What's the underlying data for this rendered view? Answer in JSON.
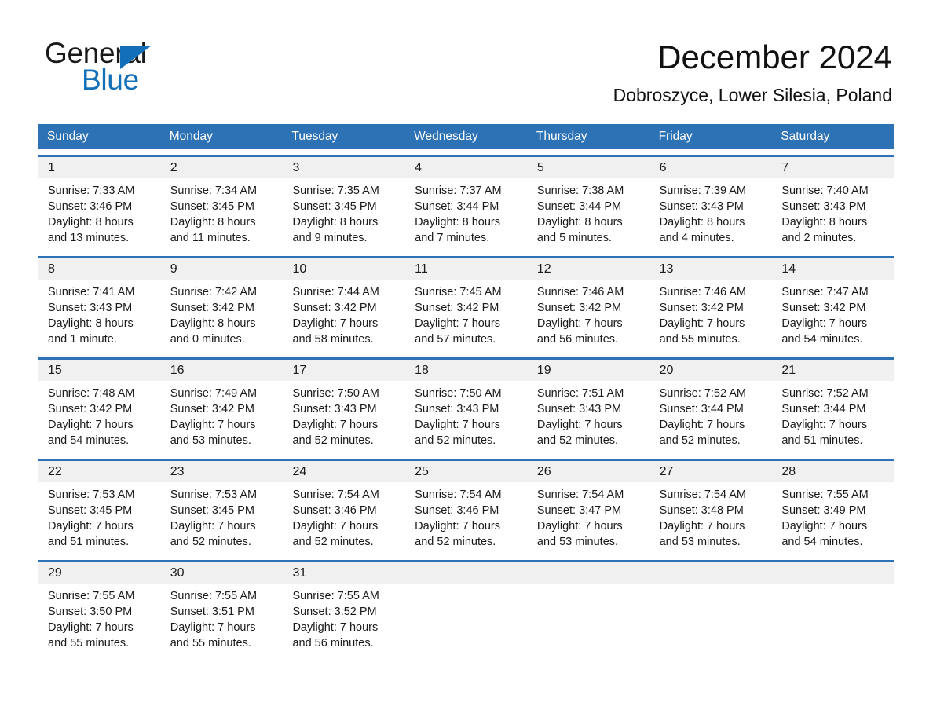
{
  "brand": {
    "name_dark": "General",
    "name_light": "Blue",
    "triangle_color": "#136fb7"
  },
  "header": {
    "title": "December 2024",
    "subtitle": "Dobroszyce, Lower Silesia, Poland",
    "accent_color": "#2d72b4",
    "daynum_band_color": "#f0f0f0"
  },
  "calendar": {
    "weekdays": [
      "Sunday",
      "Monday",
      "Tuesday",
      "Wednesday",
      "Thursday",
      "Friday",
      "Saturday"
    ],
    "weeks": [
      [
        {
          "day": "1",
          "sunrise": "Sunrise: 7:33 AM",
          "sunset": "Sunset: 3:46 PM",
          "daylight_1": "Daylight: 8 hours",
          "daylight_2": "and 13 minutes."
        },
        {
          "day": "2",
          "sunrise": "Sunrise: 7:34 AM",
          "sunset": "Sunset: 3:45 PM",
          "daylight_1": "Daylight: 8 hours",
          "daylight_2": "and 11 minutes."
        },
        {
          "day": "3",
          "sunrise": "Sunrise: 7:35 AM",
          "sunset": "Sunset: 3:45 PM",
          "daylight_1": "Daylight: 8 hours",
          "daylight_2": "and 9 minutes."
        },
        {
          "day": "4",
          "sunrise": "Sunrise: 7:37 AM",
          "sunset": "Sunset: 3:44 PM",
          "daylight_1": "Daylight: 8 hours",
          "daylight_2": "and 7 minutes."
        },
        {
          "day": "5",
          "sunrise": "Sunrise: 7:38 AM",
          "sunset": "Sunset: 3:44 PM",
          "daylight_1": "Daylight: 8 hours",
          "daylight_2": "and 5 minutes."
        },
        {
          "day": "6",
          "sunrise": "Sunrise: 7:39 AM",
          "sunset": "Sunset: 3:43 PM",
          "daylight_1": "Daylight: 8 hours",
          "daylight_2": "and 4 minutes."
        },
        {
          "day": "7",
          "sunrise": "Sunrise: 7:40 AM",
          "sunset": "Sunset: 3:43 PM",
          "daylight_1": "Daylight: 8 hours",
          "daylight_2": "and 2 minutes."
        }
      ],
      [
        {
          "day": "8",
          "sunrise": "Sunrise: 7:41 AM",
          "sunset": "Sunset: 3:43 PM",
          "daylight_1": "Daylight: 8 hours",
          "daylight_2": "and 1 minute."
        },
        {
          "day": "9",
          "sunrise": "Sunrise: 7:42 AM",
          "sunset": "Sunset: 3:42 PM",
          "daylight_1": "Daylight: 8 hours",
          "daylight_2": "and 0 minutes."
        },
        {
          "day": "10",
          "sunrise": "Sunrise: 7:44 AM",
          "sunset": "Sunset: 3:42 PM",
          "daylight_1": "Daylight: 7 hours",
          "daylight_2": "and 58 minutes."
        },
        {
          "day": "11",
          "sunrise": "Sunrise: 7:45 AM",
          "sunset": "Sunset: 3:42 PM",
          "daylight_1": "Daylight: 7 hours",
          "daylight_2": "and 57 minutes."
        },
        {
          "day": "12",
          "sunrise": "Sunrise: 7:46 AM",
          "sunset": "Sunset: 3:42 PM",
          "daylight_1": "Daylight: 7 hours",
          "daylight_2": "and 56 minutes."
        },
        {
          "day": "13",
          "sunrise": "Sunrise: 7:46 AM",
          "sunset": "Sunset: 3:42 PM",
          "daylight_1": "Daylight: 7 hours",
          "daylight_2": "and 55 minutes."
        },
        {
          "day": "14",
          "sunrise": "Sunrise: 7:47 AM",
          "sunset": "Sunset: 3:42 PM",
          "daylight_1": "Daylight: 7 hours",
          "daylight_2": "and 54 minutes."
        }
      ],
      [
        {
          "day": "15",
          "sunrise": "Sunrise: 7:48 AM",
          "sunset": "Sunset: 3:42 PM",
          "daylight_1": "Daylight: 7 hours",
          "daylight_2": "and 54 minutes."
        },
        {
          "day": "16",
          "sunrise": "Sunrise: 7:49 AM",
          "sunset": "Sunset: 3:42 PM",
          "daylight_1": "Daylight: 7 hours",
          "daylight_2": "and 53 minutes."
        },
        {
          "day": "17",
          "sunrise": "Sunrise: 7:50 AM",
          "sunset": "Sunset: 3:43 PM",
          "daylight_1": "Daylight: 7 hours",
          "daylight_2": "and 52 minutes."
        },
        {
          "day": "18",
          "sunrise": "Sunrise: 7:50 AM",
          "sunset": "Sunset: 3:43 PM",
          "daylight_1": "Daylight: 7 hours",
          "daylight_2": "and 52 minutes."
        },
        {
          "day": "19",
          "sunrise": "Sunrise: 7:51 AM",
          "sunset": "Sunset: 3:43 PM",
          "daylight_1": "Daylight: 7 hours",
          "daylight_2": "and 52 minutes."
        },
        {
          "day": "20",
          "sunrise": "Sunrise: 7:52 AM",
          "sunset": "Sunset: 3:44 PM",
          "daylight_1": "Daylight: 7 hours",
          "daylight_2": "and 52 minutes."
        },
        {
          "day": "21",
          "sunrise": "Sunrise: 7:52 AM",
          "sunset": "Sunset: 3:44 PM",
          "daylight_1": "Daylight: 7 hours",
          "daylight_2": "and 51 minutes."
        }
      ],
      [
        {
          "day": "22",
          "sunrise": "Sunrise: 7:53 AM",
          "sunset": "Sunset: 3:45 PM",
          "daylight_1": "Daylight: 7 hours",
          "daylight_2": "and 51 minutes."
        },
        {
          "day": "23",
          "sunrise": "Sunrise: 7:53 AM",
          "sunset": "Sunset: 3:45 PM",
          "daylight_1": "Daylight: 7 hours",
          "daylight_2": "and 52 minutes."
        },
        {
          "day": "24",
          "sunrise": "Sunrise: 7:54 AM",
          "sunset": "Sunset: 3:46 PM",
          "daylight_1": "Daylight: 7 hours",
          "daylight_2": "and 52 minutes."
        },
        {
          "day": "25",
          "sunrise": "Sunrise: 7:54 AM",
          "sunset": "Sunset: 3:46 PM",
          "daylight_1": "Daylight: 7 hours",
          "daylight_2": "and 52 minutes."
        },
        {
          "day": "26",
          "sunrise": "Sunrise: 7:54 AM",
          "sunset": "Sunset: 3:47 PM",
          "daylight_1": "Daylight: 7 hours",
          "daylight_2": "and 53 minutes."
        },
        {
          "day": "27",
          "sunrise": "Sunrise: 7:54 AM",
          "sunset": "Sunset: 3:48 PM",
          "daylight_1": "Daylight: 7 hours",
          "daylight_2": "and 53 minutes."
        },
        {
          "day": "28",
          "sunrise": "Sunrise: 7:55 AM",
          "sunset": "Sunset: 3:49 PM",
          "daylight_1": "Daylight: 7 hours",
          "daylight_2": "and 54 minutes."
        }
      ],
      [
        {
          "day": "29",
          "sunrise": "Sunrise: 7:55 AM",
          "sunset": "Sunset: 3:50 PM",
          "daylight_1": "Daylight: 7 hours",
          "daylight_2": "and 55 minutes."
        },
        {
          "day": "30",
          "sunrise": "Sunrise: 7:55 AM",
          "sunset": "Sunset: 3:51 PM",
          "daylight_1": "Daylight: 7 hours",
          "daylight_2": "and 55 minutes."
        },
        {
          "day": "31",
          "sunrise": "Sunrise: 7:55 AM",
          "sunset": "Sunset: 3:52 PM",
          "daylight_1": "Daylight: 7 hours",
          "daylight_2": "and 56 minutes."
        },
        {
          "day": "",
          "sunrise": "",
          "sunset": "",
          "daylight_1": "",
          "daylight_2": ""
        },
        {
          "day": "",
          "sunrise": "",
          "sunset": "",
          "daylight_1": "",
          "daylight_2": ""
        },
        {
          "day": "",
          "sunrise": "",
          "sunset": "",
          "daylight_1": "",
          "daylight_2": ""
        },
        {
          "day": "",
          "sunrise": "",
          "sunset": "",
          "daylight_1": "",
          "daylight_2": ""
        }
      ]
    ]
  }
}
